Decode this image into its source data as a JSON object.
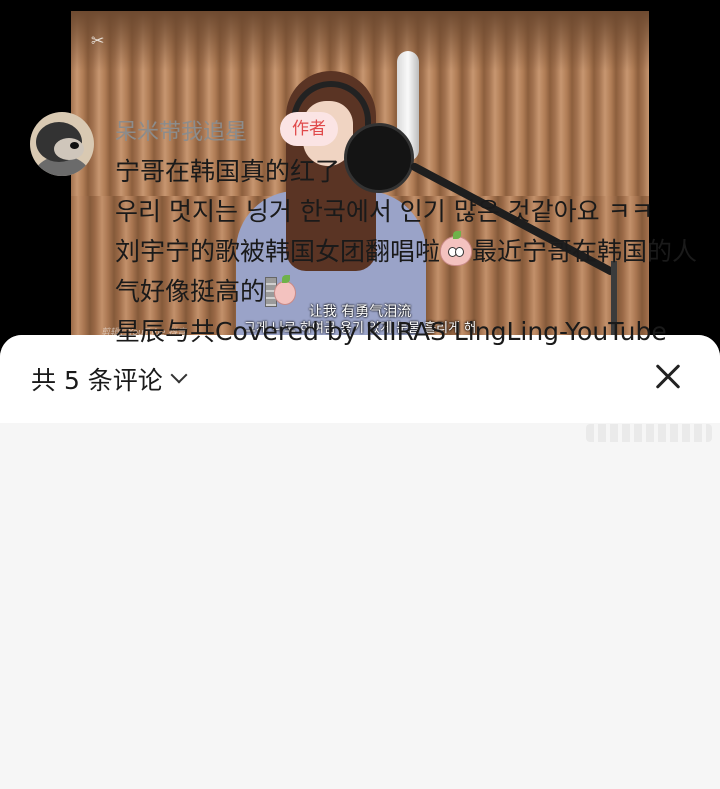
{
  "video": {
    "overlay_logo": "✂",
    "subtitle_cn": "让我 有勇气泪流",
    "subtitle_kr": "그게 나로 하여금 용기 있게 눈물 흘리게 해",
    "watermark": "剪辑：YouTube 抖音"
  },
  "sheet": {
    "comment_count_label": "共 5 条评论",
    "close_icon": "close-icon"
  },
  "comment": {
    "username": "呆米带我追星",
    "author_badge": "作者",
    "lines": {
      "l1": "宁哥在韩国真的红了",
      "l2": "우리 멋지는 닝거 한국에서 인기 많은 것같아요 ㅋㅋ",
      "l3a": "刘宇宁的歌被韩国女团翻唱啦",
      "l3b": "最近宁哥在韩国的人气好像挺高的",
      "l4": "星辰与共Covered by KIIRAS LingLing-YouTube"
    }
  },
  "colors": {
    "badge_text": "#e0494a",
    "badge_bg": "#fbe4e4",
    "username": "#8c8c8c"
  }
}
